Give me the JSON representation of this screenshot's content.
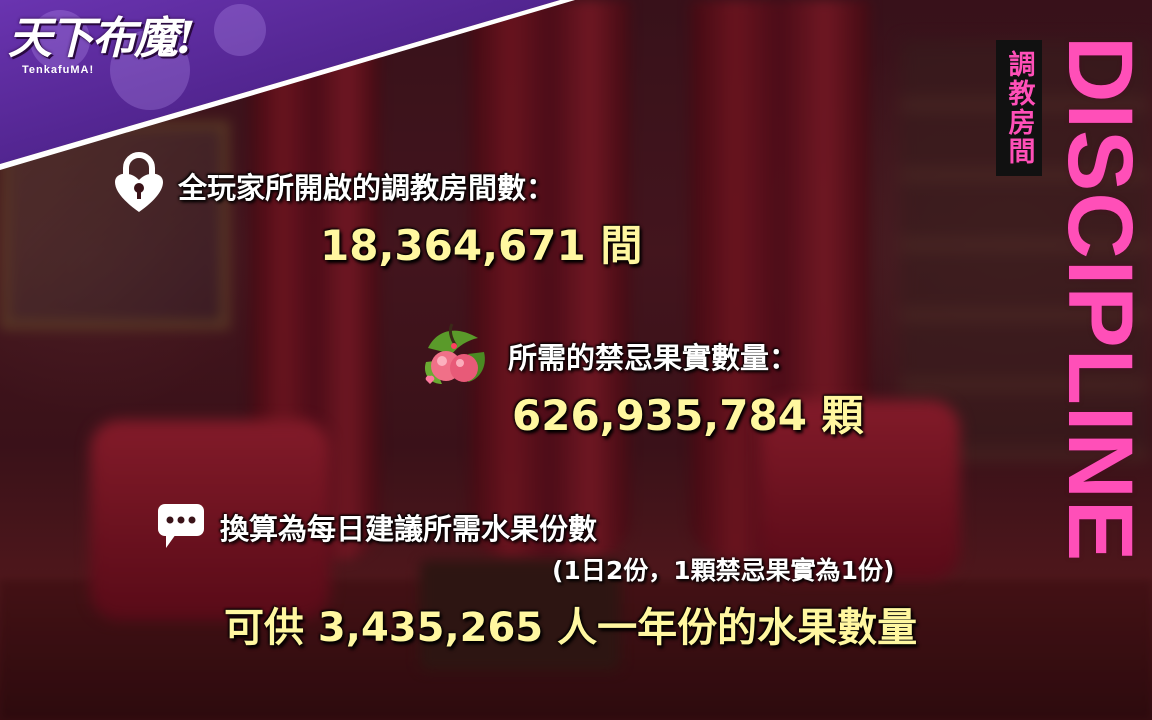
{
  "logo": {
    "title": "天下布魔!",
    "subtitle": "TenkafuMA!"
  },
  "side_tag": "調教房間",
  "side_title": "DISCIPLINE",
  "rooms": {
    "label": "全玩家所開啟的調教房間數：",
    "value": "18,364,671 間",
    "icon": "lock-icon"
  },
  "fruit": {
    "label": "所需的禁忌果實數量：",
    "value": "626,935,784 顆",
    "icon": "forbidden-fruit-icon"
  },
  "conversion": {
    "label": "換算為每日建議所需水果份數",
    "note": "(1日2份，1顆禁忌果實為1份)",
    "result": "可供 3,435,265 人一年份的水果數量",
    "icon": "chat-bubble-icon"
  },
  "colors": {
    "accent_pink": "#ff4fb8",
    "value_yellow": "#fff7a0",
    "logo_purple": "#5a2a9a"
  }
}
